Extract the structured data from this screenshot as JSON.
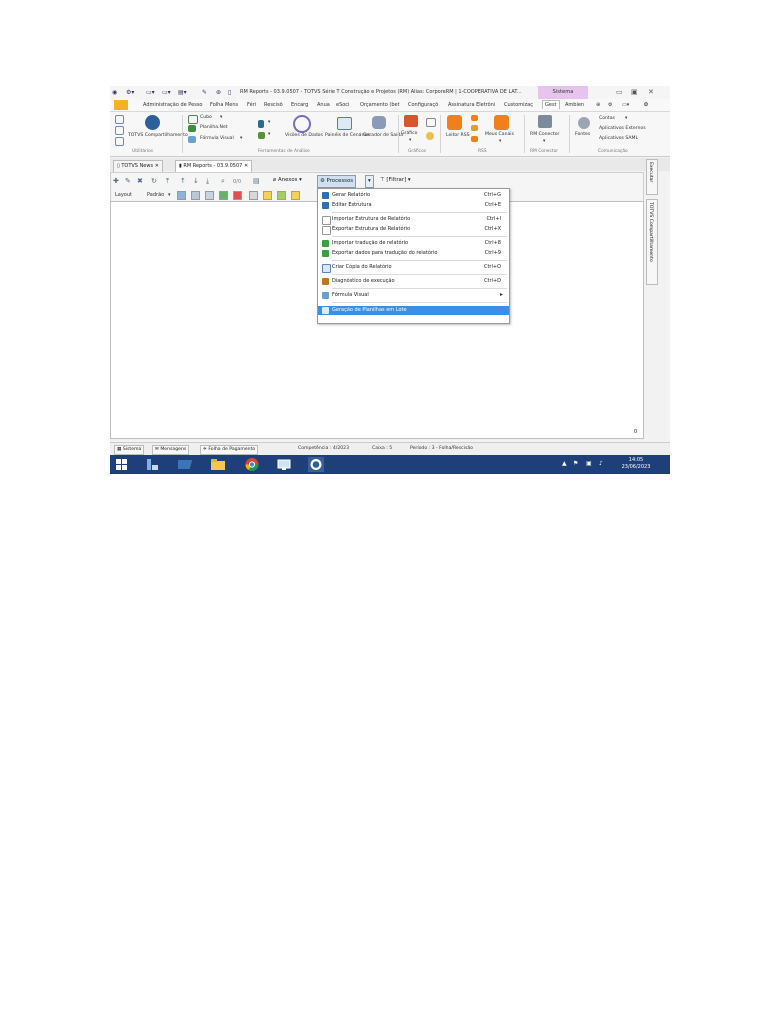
{
  "window": {
    "title": "RM Reports - 03.9.0507 - TOTVS Série T Construção e Projetos (RM) Alias: CorporeRM | 1-COOPERATIVA DE LAT...",
    "context_tab": "Sistema"
  },
  "menubar": {
    "items": [
      "Administração de Pesso",
      "Folha Mens",
      "Féri",
      "Rescisõ",
      "Encarg",
      "Anua",
      "eSoci",
      "Orçamento (bet",
      "Configuraçõ",
      "Assinatura Eletrôni",
      "Customizaç",
      "Gest",
      "Ambien"
    ]
  },
  "ribbon": {
    "utilitarios": {
      "totvs_label": "TOTVS Compartilhamento",
      "group": "Utilitários"
    },
    "ferramentas": {
      "cubo": "Cubo",
      "planilha": "Planilha.Net",
      "formula": "Fórmula Visual",
      "visoes": "Visões de Dados",
      "paineis": "Painéis de Cenários",
      "gerador": "Gerador de Saída",
      "group": "Ferramentas de Análise"
    },
    "graficos": {
      "grafico": "Gráfico",
      "group": "Gráficos"
    },
    "rss": {
      "leitor": "Leitor RSS",
      "meus_canais": "Meus Canais",
      "group": "RSS"
    },
    "rm_conector": {
      "label": "RM Conector",
      "group": "RM Conector"
    },
    "comunicacao": {
      "fontes": "Fontes",
      "contas": "Contas",
      "apps_ext": "Aplicativos Externos",
      "apps_saml": "Aplicativos SAML",
      "group": "Comunicação"
    }
  },
  "doc_tabs": [
    {
      "label": "TOTVS News"
    },
    {
      "label": "RM Reports - 03.9.0507"
    }
  ],
  "toolbar": {
    "zoom": "0/0",
    "anexos": "Anexos",
    "processos": "Processos",
    "filtrar": "[Filtrar]",
    "layout": "Layout",
    "padrao": "Padrão"
  },
  "processes_menu": [
    {
      "label": "Gerar Relatório",
      "shortcut": "Ctrl+G"
    },
    {
      "label": "Editar Estrutura",
      "shortcut": "Ctrl+E"
    },
    {
      "label": "Importar Estrutura de Relatório",
      "shortcut": "Ctrl+I"
    },
    {
      "label": "Exportar Estrutura de Relatório",
      "shortcut": "Ctrl+X"
    },
    {
      "label": "Importar tradução de relatório",
      "shortcut": "Ctrl+8"
    },
    {
      "label": "Exportar dados para tradução do relatório",
      "shortcut": "Ctrl+9"
    },
    {
      "label": "Criar Cópia do Relatório",
      "shortcut": "Ctrl+O"
    },
    {
      "label": "Diagnóstico de execução",
      "shortcut": "Ctrl+D"
    },
    {
      "label": "Fórmula Visual",
      "shortcut": ""
    },
    {
      "label": "Geração de Planilhas em Lote",
      "shortcut": ""
    }
  ],
  "grid": {
    "record_count": "0"
  },
  "right_rail": {
    "executar": "Executar",
    "compartilhamento": "TOTVS Compartilhamento"
  },
  "statusbar": {
    "sistema": "Sistema",
    "mensagens": "Mensagens",
    "folha": "Folha de Pagamento",
    "competencia": "Competência : 4/2023",
    "caixa": "Caixa : 5",
    "periodo": "Período : 3 - Folha/Rescisão"
  },
  "taskbar": {
    "time": "14:05",
    "date": "23/06/2023"
  },
  "colors": {
    "accent": "#3c8fe3",
    "taskbar": "#1f3f7a",
    "sistema_tab": "#e7c4ee",
    "home_tab": "#f0b422"
  }
}
